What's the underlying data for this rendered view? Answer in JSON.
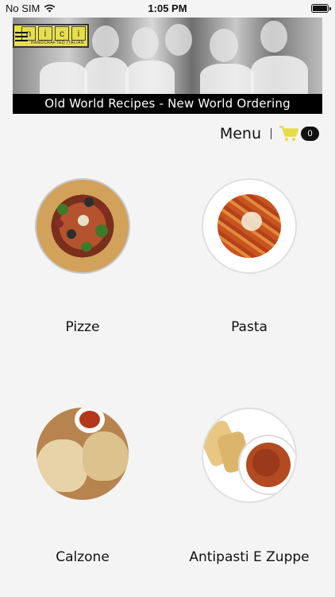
{
  "status_bar": {
    "carrier": "No SIM",
    "time": "1:05 PM"
  },
  "header": {
    "logo_letters": [
      "n",
      "i",
      "c",
      "i"
    ],
    "logo_tagline": "HANDCRAFTED ITALIAN",
    "tagline": "Old World Recipes - New World Ordering"
  },
  "toolbar": {
    "menu_label": "Menu",
    "cart_count": "0",
    "accent": "#e5dc4a"
  },
  "categories": [
    {
      "label": "Pizze"
    },
    {
      "label": "Pasta"
    },
    {
      "label": "Calzone"
    },
    {
      "label": "Antipasti E Zuppe"
    }
  ]
}
